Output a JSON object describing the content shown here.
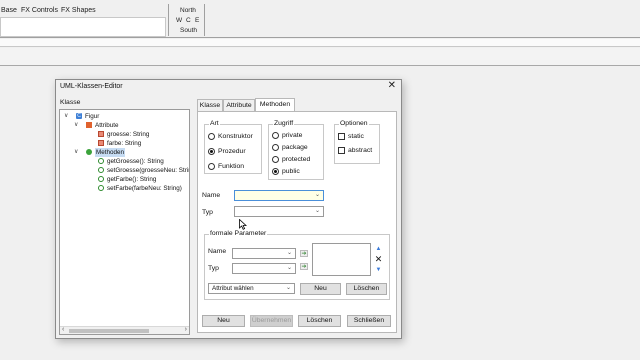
{
  "palette": {
    "tabs": [
      "Base",
      "FX Controls",
      "FX Shapes"
    ]
  },
  "compass": {
    "north": "North",
    "west": "W",
    "center": "C",
    "east": "E",
    "south": "South"
  },
  "dialog": {
    "title": "UML-Klassen-Editor",
    "close_icon": "close-icon",
    "class_label": "Klasse",
    "tree": [
      {
        "label": "Figur",
        "icon": "class-icon",
        "level": 0,
        "toggle": "∨"
      },
      {
        "label": "Attribute",
        "icon": "attribute-folder-icon",
        "level": 1,
        "toggle": "∨"
      },
      {
        "label": "groesse: String",
        "icon": "attribute-icon",
        "level": 2
      },
      {
        "label": "farbe: String",
        "icon": "attribute-icon",
        "level": 2
      },
      {
        "label": "Methoden",
        "icon": "method-folder-icon",
        "level": 1,
        "toggle": "∨",
        "selected": true
      },
      {
        "label": "getGroesse(): String",
        "icon": "method-icon",
        "level": 2
      },
      {
        "label": "setGroesse(groesseNeu: String",
        "icon": "method-icon",
        "level": 2
      },
      {
        "label": "getFarbe(): String",
        "icon": "method-icon",
        "level": 2
      },
      {
        "label": "setFarbe(farbeNeu: String)",
        "icon": "method-icon",
        "level": 2
      }
    ],
    "tabs": [
      "Klasse",
      "Attribute",
      "Methoden"
    ],
    "active_tab": "Methoden",
    "art": {
      "title": "Art",
      "options": [
        "Konstruktor",
        "Prozedur",
        "Funktion"
      ],
      "selected": "Prozedur"
    },
    "zugriff": {
      "title": "Zugriff",
      "options": [
        "private",
        "package",
        "protected",
        "public"
      ],
      "selected": "public"
    },
    "optionen": {
      "title": "Optionen",
      "options": [
        "static",
        "abstract"
      ]
    },
    "name_label": "Name",
    "typ_label": "Typ",
    "name_value": "",
    "typ_value": "",
    "params": {
      "title": "formale Parameter",
      "name_label": "Name",
      "typ_label": "Typ",
      "attribut_select": "Attribut wählen",
      "neu": "Neu",
      "loeschen": "Löschen"
    },
    "buttons": {
      "neu": "Neu",
      "uebernehmen": "Übernehmen",
      "loeschen": "Löschen",
      "schliessen": "Schließen"
    },
    "colors": {
      "selection": "#c6dcf3",
      "focus_field": "#ffffe6",
      "focus_border": "#4a8fd9"
    }
  }
}
